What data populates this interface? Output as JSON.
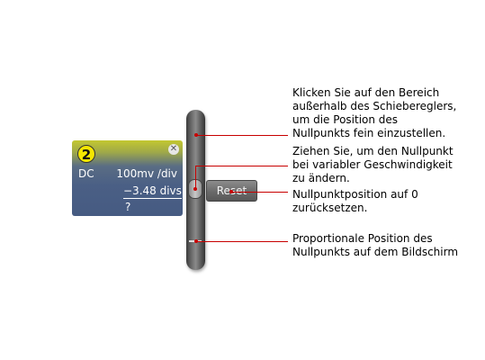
{
  "channel_panel": {
    "number": "2",
    "coupling": "DC",
    "scale": "100mv /div",
    "offset": "−3.48 divs",
    "extra": "?",
    "colors": {
      "badge": "#f4e600",
      "panel_top": "#c3c730",
      "panel_bottom": "#465b82"
    },
    "close_icon": "close-icon"
  },
  "reset_button": {
    "label": "Reset"
  },
  "annotations": [
    {
      "id": "fine-adjust",
      "text": "Klicken Sie auf den Bereich\naußerhalb des Schiebereglers,\num die Position des\nNullpunkts fein einzustellen."
    },
    {
      "id": "drag-zero",
      "text": "Ziehen Sie, um den Nullpunkt\nbei variabler Geschwindigkeit\nzu ändern."
    },
    {
      "id": "reset-zero",
      "text": "Nullpunktposition auf 0\nzurücksetzen."
    },
    {
      "id": "proportional-position",
      "text": "Proportionale Position des\nNullpunkts auf dem Bildschirm"
    }
  ],
  "colors": {
    "leader_line": "#c80000"
  }
}
